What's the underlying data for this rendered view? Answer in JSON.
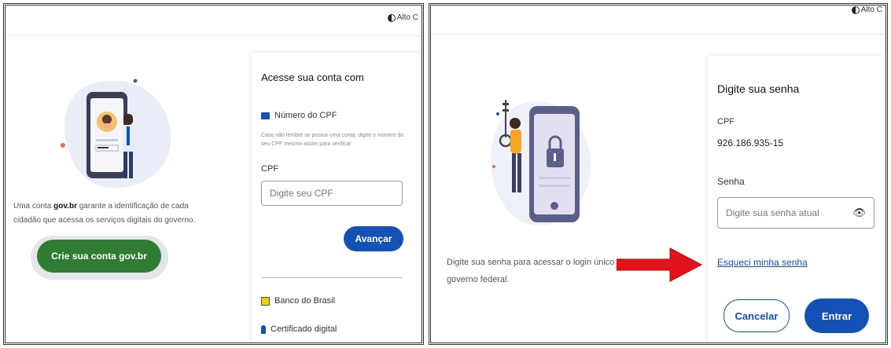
{
  "left": {
    "contrast_label": "Alto C",
    "intro_text_line1": "Uma conta ",
    "intro_text_bold": "gov.br",
    "intro_text_line1_rest": " garante a identificação de cada",
    "intro_text_line2": "cidadão que acessa os serviços digitais do governo.",
    "create_account_button": "Crie sua conta gov.br",
    "card": {
      "title": "Acesse sua conta com",
      "option_cpf": "Número do CPF",
      "hint_line1": "Caso não lembre se possui uma conta, digite o número do",
      "hint_line2": "seu CPF mesmo assim para verificar",
      "cpf_label": "CPF",
      "cpf_placeholder": "Digite seu CPF",
      "next_button": "Avançar",
      "option_bank": "Banco do Brasil",
      "option_certificate": "Certificado digital"
    }
  },
  "right": {
    "contrast_label": "Alto C",
    "intro_line1": "Digite sua senha para acessar o login único do",
    "intro_line2": "governo federal.",
    "card": {
      "title": "Digite sua senha",
      "cpf_label": "CPF",
      "cpf_value": "926.186.935-15",
      "password_label": "Senha",
      "password_placeholder": "Digite sua senha atual",
      "forgot_link": "Esqueci minha senha",
      "cancel_button": "Cancelar",
      "enter_button": "Entrar"
    }
  },
  "colors": {
    "green": "#2e7d32",
    "blue": "#1351b4",
    "arrow_red": "#e3131b",
    "illustration_bg": "#e8edf8"
  }
}
